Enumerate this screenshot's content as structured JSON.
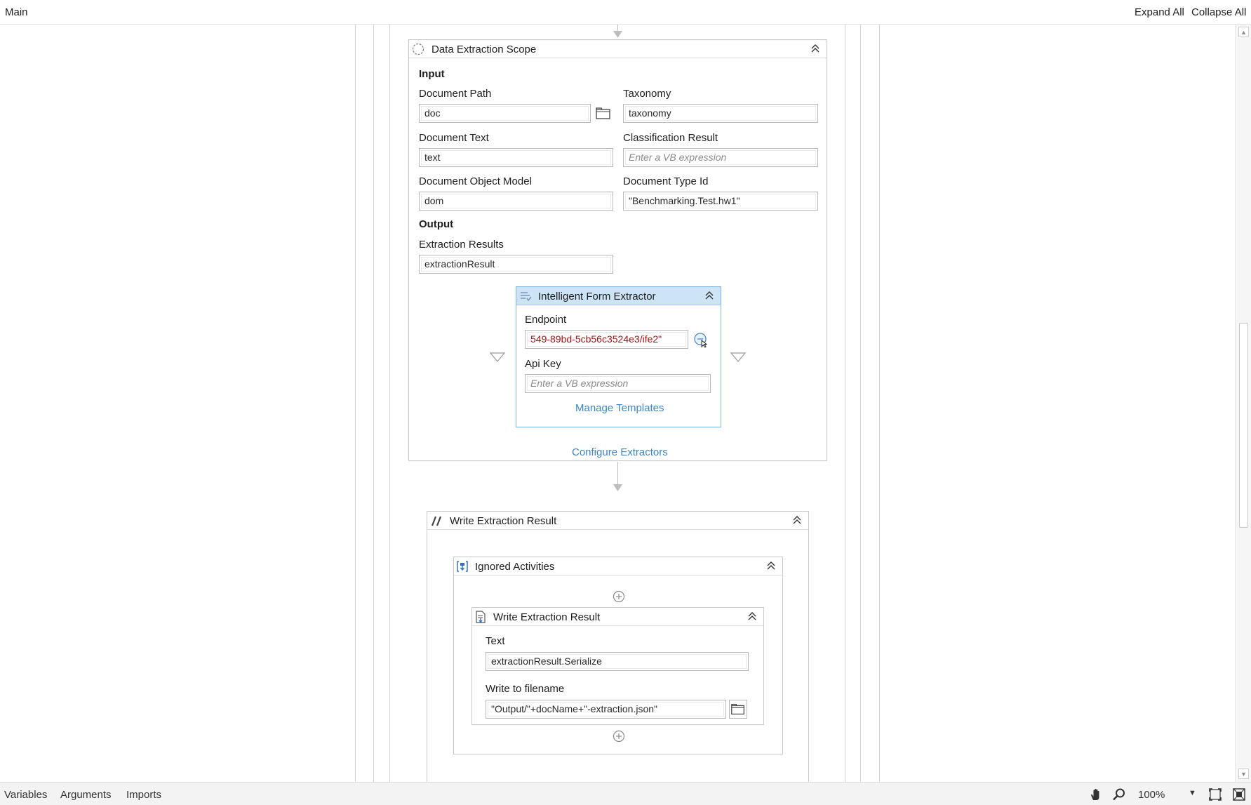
{
  "topbar": {
    "breadcrumb": "Main",
    "expand_all": "Expand All",
    "collapse_all": "Collapse All"
  },
  "scope": {
    "title": "Data Extraction Scope",
    "input_header": "Input",
    "document_path": {
      "label": "Document Path",
      "value": "doc"
    },
    "taxonomy": {
      "label": "Taxonomy",
      "value": "taxonomy"
    },
    "document_text": {
      "label": "Document Text",
      "value": "text"
    },
    "classification_result": {
      "label": "Classification Result",
      "placeholder": "Enter a VB expression"
    },
    "document_object_model": {
      "label": "Document Object Model",
      "value": "dom"
    },
    "document_type_id": {
      "label": "Document Type Id",
      "value": "\"Benchmarking.Test.hw1\""
    },
    "output_header": "Output",
    "extraction_results": {
      "label": "Extraction Results",
      "value": "extractionResult"
    },
    "configure_link": "Configure Extractors"
  },
  "extractor": {
    "title": "Intelligent Form Extractor",
    "endpoint": {
      "label": "Endpoint",
      "value": "549-89bd-5cb56c3524e3/ife2\""
    },
    "api_key": {
      "label": "Api Key",
      "placeholder": "Enter a VB expression"
    },
    "manage_link": "Manage Templates"
  },
  "write_outer": {
    "title": "Write Extraction Result"
  },
  "ignored": {
    "title": "Ignored Activities"
  },
  "write_inner": {
    "title": "Write Extraction Result",
    "text": {
      "label": "Text",
      "value": "extractionResult.Serialize"
    },
    "filename": {
      "label": "Write to filename",
      "value": "\"Output/\"+docName+\"-extraction.json\""
    }
  },
  "bottombar": {
    "tabs": [
      "Variables",
      "Arguments",
      "Imports"
    ],
    "zoom": "100%"
  },
  "icons": [
    "hand-icon",
    "search-icon",
    "fit-to-screen-icon",
    "overview-icon",
    "folder-icon",
    "collapse-icon",
    "add-activity-icon"
  ],
  "colors": {
    "link": "#3d86c6",
    "selected_header": "#cde3f6",
    "string_literal": "#a31515"
  }
}
